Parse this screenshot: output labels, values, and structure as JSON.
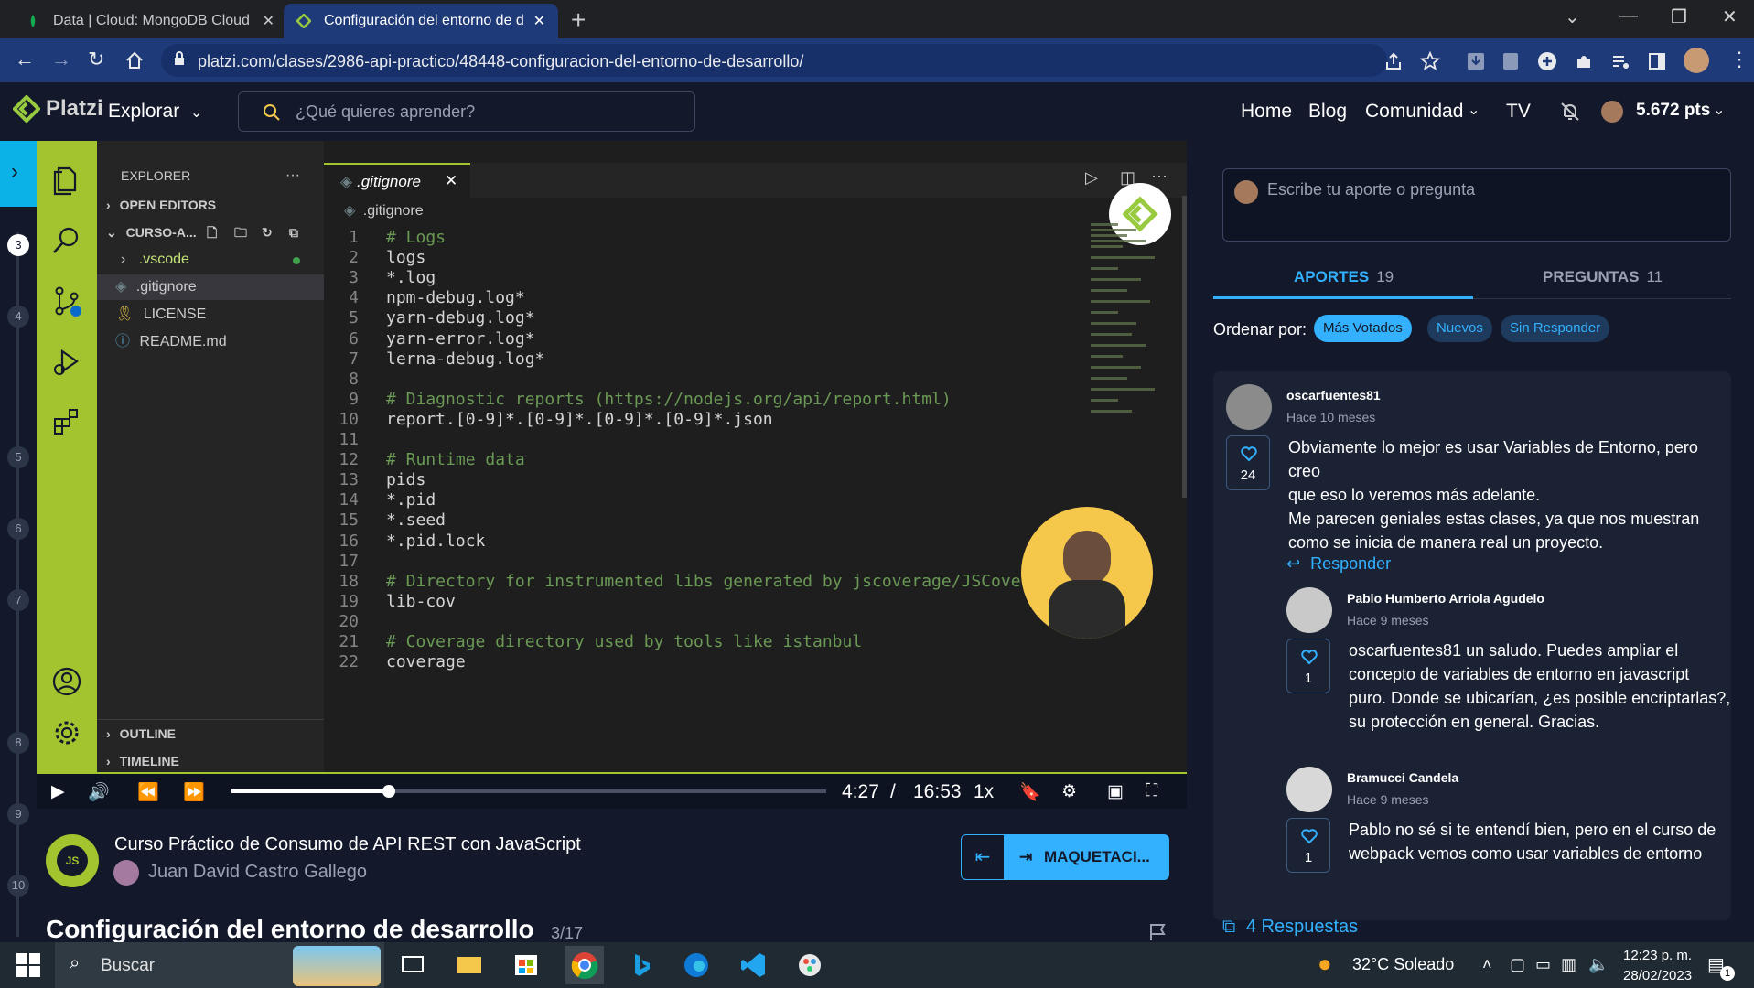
{
  "browser": {
    "tabs": [
      {
        "title": "Data | Cloud: MongoDB Cloud",
        "active": false
      },
      {
        "title": "Configuración del entorno de de",
        "active": true
      }
    ],
    "url": "platzi.com/clases/2986-api-practico/48448-configuracion-del-entorno-de-desarrollo/"
  },
  "platzi_header": {
    "logo": "Platzi",
    "explore": "Explorar",
    "search_placeholder": "¿Qué quieres aprender?",
    "nav": [
      "Home",
      "Blog",
      "Comunidad",
      "TV"
    ],
    "points": "5.672 pts"
  },
  "progress_sidebar": {
    "numbers": [
      "3",
      "4",
      "5",
      "6",
      "7",
      "8",
      "9",
      "10"
    ]
  },
  "vscode": {
    "explorer_title": "EXPLORER",
    "open_editors": "OPEN EDITORS",
    "folder": "CURSO-A...",
    "files": [
      ".vscode",
      ".gitignore",
      "LICENSE",
      "README.md"
    ],
    "outline": "OUTLINE",
    "timeline": "TIMELINE",
    "tab": ".gitignore",
    "breadcrumb": ".gitignore",
    "lines": [
      {
        "n": "1",
        "text": "# Logs",
        "type": "comment"
      },
      {
        "n": "2",
        "text": "logs",
        "type": "text"
      },
      {
        "n": "3",
        "text": "*.log",
        "type": "text"
      },
      {
        "n": "4",
        "text": "npm-debug.log*",
        "type": "text"
      },
      {
        "n": "5",
        "text": "yarn-debug.log*",
        "type": "text"
      },
      {
        "n": "6",
        "text": "yarn-error.log*",
        "type": "text"
      },
      {
        "n": "7",
        "text": "lerna-debug.log*",
        "type": "text"
      },
      {
        "n": "8",
        "text": "",
        "type": "text"
      },
      {
        "n": "9",
        "text": "# Diagnostic reports (https://nodejs.org/api/report.html)",
        "type": "comment"
      },
      {
        "n": "10",
        "text": "report.[0-9]*.[0-9]*.[0-9]*.[0-9]*.json",
        "type": "text"
      },
      {
        "n": "11",
        "text": "",
        "type": "text"
      },
      {
        "n": "12",
        "text": "# Runtime data",
        "type": "comment"
      },
      {
        "n": "13",
        "text": "pids",
        "type": "text"
      },
      {
        "n": "14",
        "text": "*.pid",
        "type": "text"
      },
      {
        "n": "15",
        "text": "*.seed",
        "type": "text"
      },
      {
        "n": "16",
        "text": "*.pid.lock",
        "type": "text"
      },
      {
        "n": "17",
        "text": "",
        "type": "text"
      },
      {
        "n": "18",
        "text": "# Directory for instrumented libs generated by jscoverage/JSCove",
        "type": "comment"
      },
      {
        "n": "19",
        "text": "lib-cov",
        "type": "text"
      },
      {
        "n": "20",
        "text": "",
        "type": "text"
      },
      {
        "n": "21",
        "text": "# Coverage directory used by tools like istanbul",
        "type": "comment"
      },
      {
        "n": "22",
        "text": "coverage",
        "type": "text"
      }
    ]
  },
  "player": {
    "current_time": "4:27",
    "separator": "/",
    "duration": "16:53",
    "speed": "1x",
    "progress_fraction": 0.264
  },
  "course": {
    "title": "Curso Práctico de Consumo de API REST con JavaScript",
    "author": "Juan David Castro Gallego",
    "next_label": "MAQUETACI...",
    "class_title": "Configuración del entorno de desarrollo",
    "class_count": "3/17"
  },
  "comments_panel": {
    "ask_placeholder": "Escribe tu aporte o pregunta",
    "tabs": [
      {
        "label": "APORTES",
        "count": "19",
        "active": true
      },
      {
        "label": "PREGUNTAS",
        "count": "11",
        "active": false
      }
    ],
    "order_label": "Ordenar por:",
    "filters": [
      {
        "label": "Más Votados",
        "active": true
      },
      {
        "label": "Nuevos",
        "active": false
      },
      {
        "label": "Sin Responder",
        "active": false
      }
    ],
    "main_comment": {
      "user": "oscarfuentes81",
      "time": "Hace 10 meses",
      "likes": "24",
      "lines": [
        "Obviamente lo mejor es usar Variables de Entorno, pero creo",
        "que eso lo veremos más adelante.",
        "Me parecen geniales estas clases, ya que nos muestran",
        "como se inicia de manera real un proyecto."
      ],
      "reply_label": "Responder"
    },
    "replies": [
      {
        "user": "Pablo Humberto Arriola Agudelo",
        "time": "Hace 9 meses",
        "likes": "1",
        "lines": [
          "oscarfuentes81 un saludo. Puedes ampliar el",
          "concepto de variables de entorno en javascript",
          "puro. Donde se ubicarían, ¿es posible encriptarlas?,",
          "su protección en general. Gracias."
        ]
      },
      {
        "user": "Bramucci Candela",
        "time": "Hace 9 meses",
        "likes": "1",
        "lines": [
          "Pablo no sé si te entendí bien, pero en el curso de",
          "webpack vemos como usar variables de entorno"
        ]
      }
    ],
    "replies_link": "4 Respuestas"
  },
  "taskbar": {
    "search_placeholder": "Buscar",
    "weather": "32°C Soleado",
    "time": "12:23 p. m.",
    "date": "28/02/2023",
    "notifications": "1"
  },
  "colors": {
    "platzi_green": "#a2c42f",
    "accent_blue": "#33b1ff",
    "background": "#13192b"
  }
}
